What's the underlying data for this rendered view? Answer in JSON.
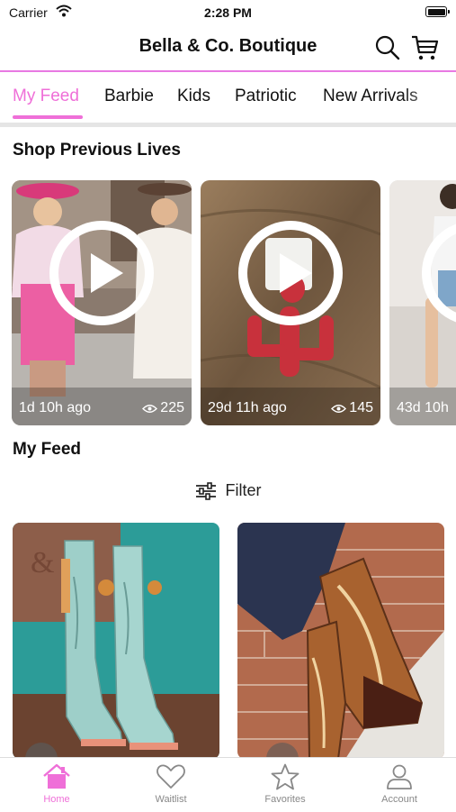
{
  "status_bar": {
    "carrier": "Carrier",
    "time": "2:28 PM"
  },
  "header": {
    "title": "Bella & Co. Boutique",
    "search_icon": "search-icon",
    "cart_icon": "cart-icon"
  },
  "tabs": [
    {
      "label": "My Feed",
      "active": true
    },
    {
      "label": "Barbie"
    },
    {
      "label": "Kids"
    },
    {
      "label": "Patriotic"
    },
    {
      "label": "New Arrivals"
    }
  ],
  "previous_lives": {
    "title": "Shop Previous Lives",
    "items": [
      {
        "ago": "1d 10h ago",
        "views": "225"
      },
      {
        "ago": "29d 11h ago",
        "views": "145"
      },
      {
        "ago": "43d 10h"
      }
    ]
  },
  "feed": {
    "title": "My Feed",
    "filter_label": "Filter"
  },
  "bottom_nav": [
    {
      "label": "Home",
      "icon": "home-icon",
      "active": true
    },
    {
      "label": "Waitlist",
      "icon": "heart-icon"
    },
    {
      "label": "Favorites",
      "icon": "star-icon"
    },
    {
      "label": "Account",
      "icon": "person-icon"
    }
  ],
  "colors": {
    "accent": "#ef6fd8",
    "header_line": "#e879e3"
  }
}
